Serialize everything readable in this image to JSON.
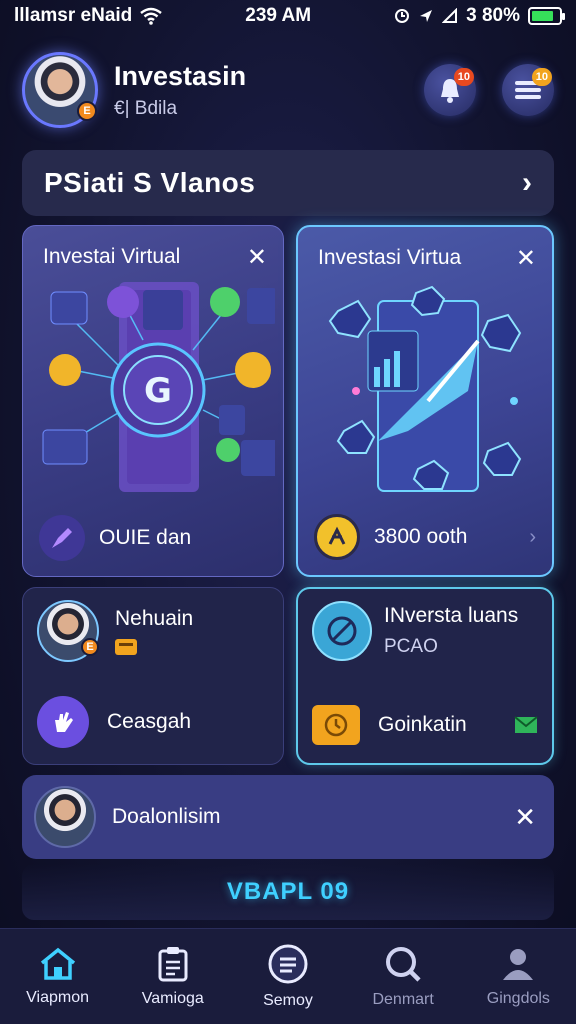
{
  "status_bar": {
    "carrier": "lllamsr eNaid",
    "time": "239 AM",
    "battery_text": "3 80%",
    "battery_level": 0.8
  },
  "header": {
    "title": "Investasin",
    "subtitle": "€| Bdila",
    "avatar_badge": "E",
    "notif_badge": "10",
    "menu_badge": "10"
  },
  "banner": {
    "title": "PSiati S Vlanos"
  },
  "cards": [
    {
      "title": "Investai Virtual",
      "footer_label": "OUIE dan"
    },
    {
      "title": "Investasi Virtua",
      "footer_label": "3800 ooth"
    }
  ],
  "row_left": {
    "title": "Nehuain",
    "action_label": "Ceasgah",
    "avatar_badge": "E"
  },
  "row_right": {
    "title": "INversta luans",
    "subtitle": "PCAO",
    "action_label": "Goinkatin"
  },
  "notice": {
    "title": "Doalonlisim"
  },
  "promo": {
    "text": "VBAPL 09"
  },
  "nav": [
    {
      "label": "Viapmon",
      "icon": "home-icon"
    },
    {
      "label": "Vamioga",
      "icon": "clipboard-icon"
    },
    {
      "label": "Semoy",
      "icon": "message-icon"
    },
    {
      "label": "Denmart",
      "icon": "search-icon"
    },
    {
      "label": "Gingdols",
      "icon": "profile-icon"
    }
  ],
  "colors": {
    "accent": "#3fd0ff",
    "badge": "#e8491f",
    "battery": "#36e05a"
  }
}
